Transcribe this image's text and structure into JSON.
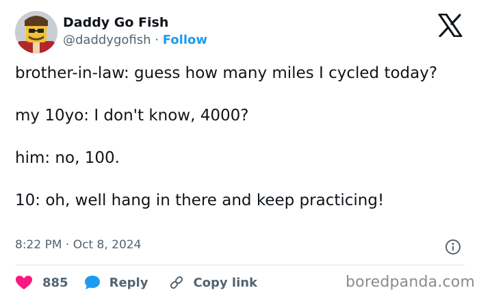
{
  "author": {
    "name": "Daddy Go Fish",
    "handle": "@daddygofish",
    "separator": "·",
    "follow_label": "Follow"
  },
  "tweet": {
    "lines": [
      "brother-in-law: guess how many miles I cycled today?",
      "my 10yo: I don't know, 4000?",
      "him: no, 100.",
      "10: oh, well hang in there and keep practicing!"
    ],
    "timestamp": "8:22 PM · Oct 8, 2024"
  },
  "actions": {
    "like_count": "885",
    "reply_label": "Reply",
    "copy_link_label": "Copy link"
  },
  "icons": {
    "platform_logo": "x-logo-icon",
    "info": "info-icon",
    "like": "heart-icon",
    "reply": "speech-bubble-icon",
    "copy_link": "link-icon"
  },
  "colors": {
    "like": "#f91880",
    "reply": "#1d9bf0",
    "follow": "#1d9bf0",
    "secondary_text": "#536471"
  },
  "watermark": "boredpanda.com"
}
